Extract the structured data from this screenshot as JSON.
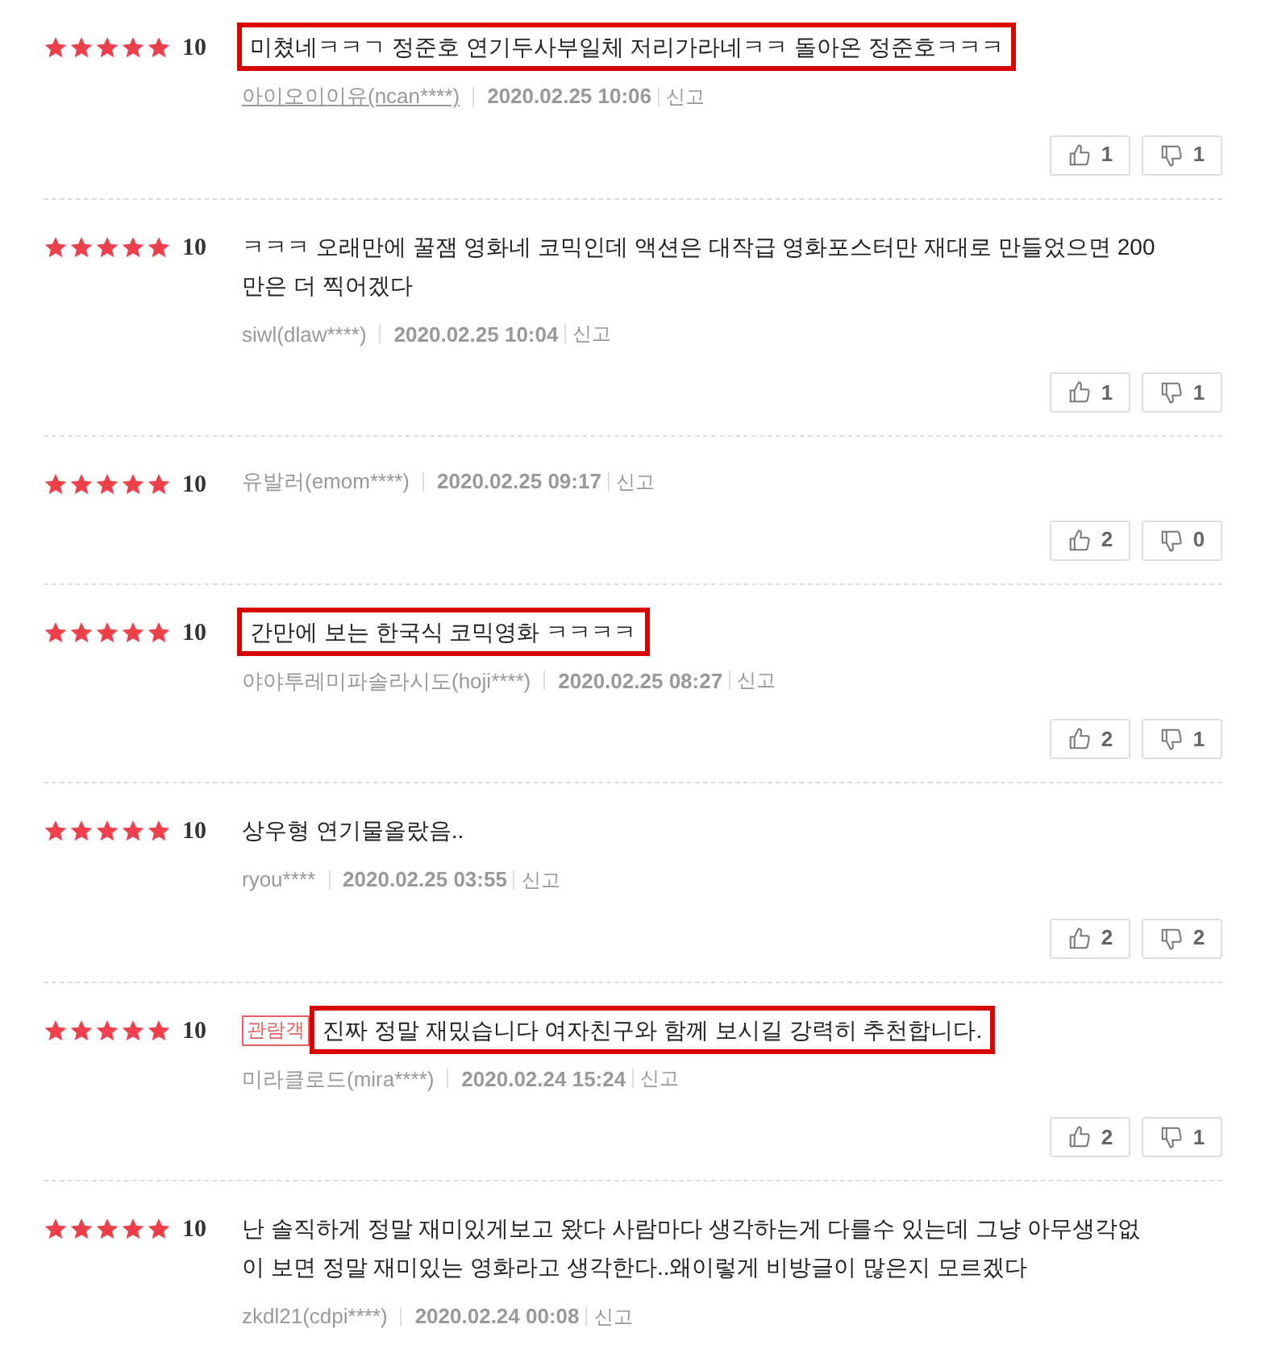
{
  "reviews": [
    {
      "stars": 5,
      "score": "10",
      "text": "미쳤네ㅋㅋㄱ 정준호 연기두사부일체 저리가라네ㅋㅋ 돌아온 정준호ㅋㅋㅋ",
      "highlighted": true,
      "author": "아이오이이유(ncan****)",
      "author_link": true,
      "date": "2020.02.25 10:06",
      "report": "신고",
      "likes": "1",
      "dislikes": "1"
    },
    {
      "stars": 5,
      "score": "10",
      "text": "ㅋㅋㅋ 오래만에 꿀잼 영화네 코믹인데 액션은 대작급 영화포스터만 재대로 만들었으면 200만은 더 찍어겠다",
      "highlighted": false,
      "author": "siwl(dlaw****)",
      "author_link": false,
      "date": "2020.02.25 10:04",
      "report": "신고",
      "likes": "1",
      "dislikes": "1"
    },
    {
      "stars": 5,
      "score": "10",
      "author": "유발러(emom****)",
      "author_link": false,
      "date": "2020.02.25 09:17",
      "report": "신고",
      "likes": "2",
      "dislikes": "0"
    },
    {
      "stars": 5,
      "score": "10",
      "text": "간만에 보는 한국식 코믹영화 ㅋㅋㅋㅋ",
      "highlighted": true,
      "author": "야야투레미파솔라시도(hoji****)",
      "author_link": false,
      "date": "2020.02.25 08:27",
      "report": "신고",
      "likes": "2",
      "dislikes": "1"
    },
    {
      "stars": 5,
      "score": "10",
      "text": "상우형 연기물올랐음..",
      "highlighted": false,
      "author": "ryou****",
      "author_link": false,
      "date": "2020.02.25 03:55",
      "report": "신고",
      "likes": "2",
      "dislikes": "2"
    },
    {
      "stars": 5,
      "score": "10",
      "badge": "관람객",
      "text": "진짜 정말 재밌습니다 여자친구와 함께 보시길 강력히 추천합니다.",
      "highlighted": true,
      "author": "미라클로드(mira****)",
      "author_link": false,
      "date": "2020.02.24 15:24",
      "report": "신고",
      "likes": "2",
      "dislikes": "1"
    },
    {
      "stars": 5,
      "score": "10",
      "text": "난 솔직하게 정말 재미있게보고 왔다 사람마다 생각하는게 다를수 있는데 그냥 아무생각없이 보면 정말 재미있는 영화라고 생각한다..왜이렇게 비방글이 많은지 모르겠다",
      "highlighted": false,
      "author": "zkdl21(cdpi****)",
      "author_link": false,
      "date": "2020.02.24 00:08",
      "report": "신고"
    }
  ]
}
